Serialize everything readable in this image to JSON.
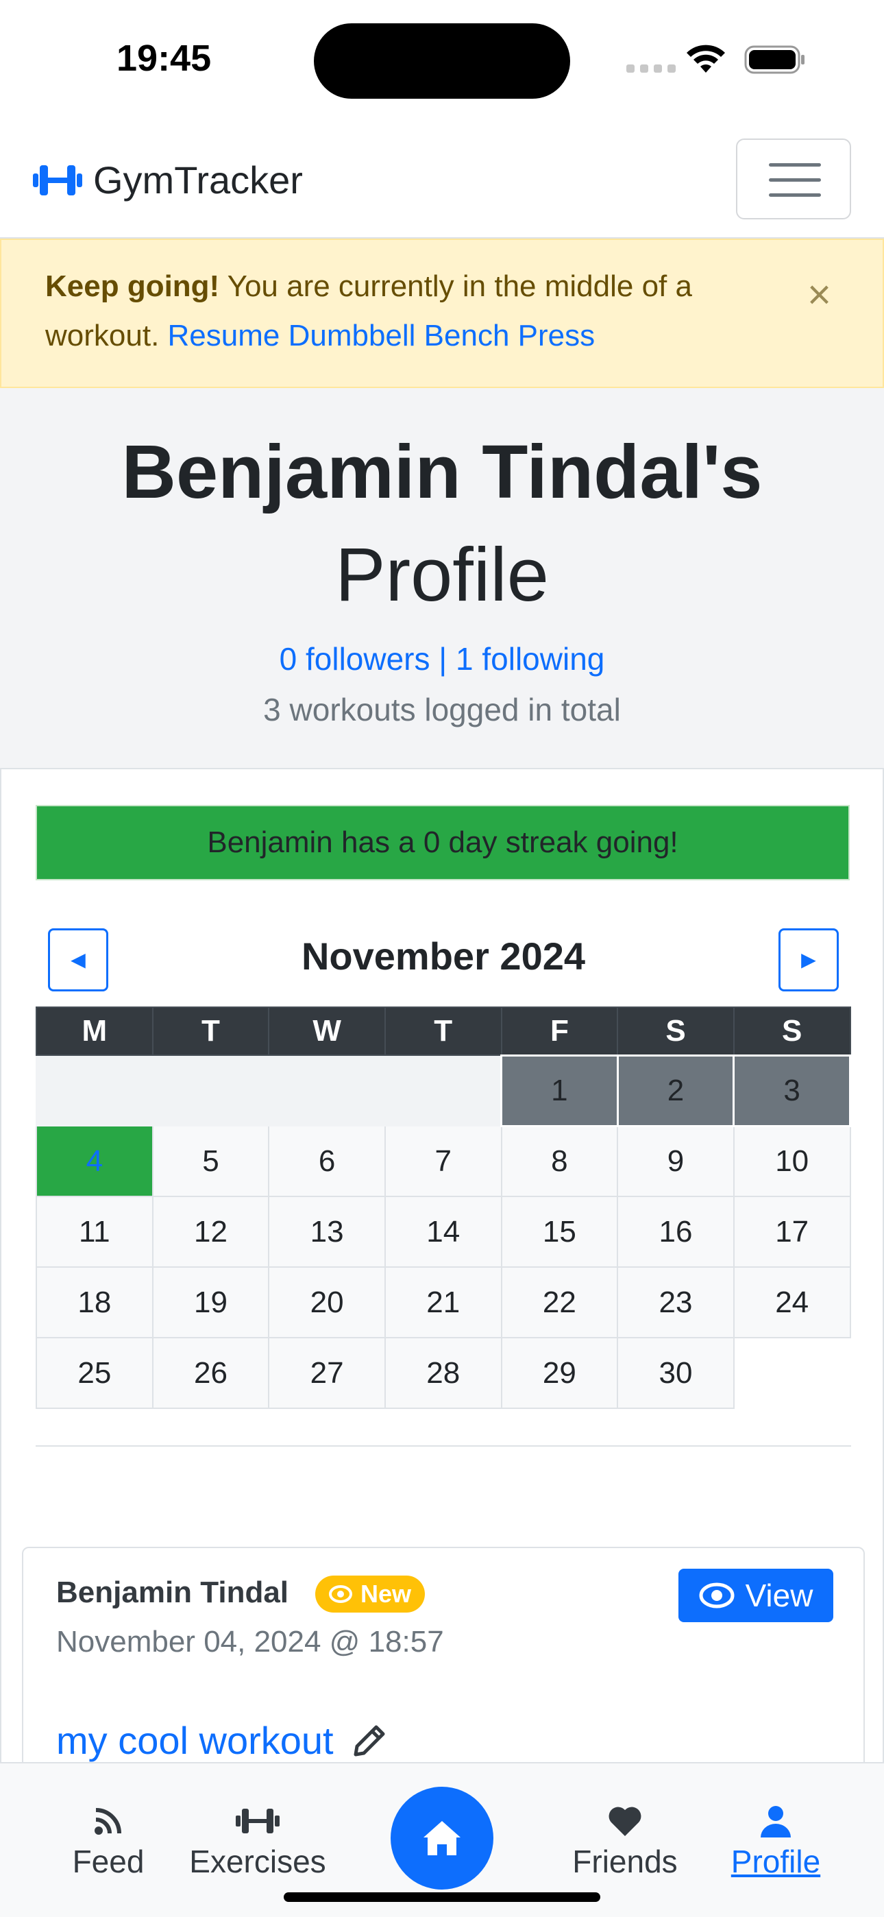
{
  "status_bar": {
    "time": "19:45"
  },
  "navbar": {
    "brand": "GymTracker"
  },
  "alert": {
    "strong": "Keep going!",
    "text": " You are currently in the middle of a workout. ",
    "link": "Resume Dumbbell Bench Press",
    "close": "×"
  },
  "profile": {
    "name": "Benjamin Tindal's",
    "title_suffix": "Profile",
    "followers": "0 followers",
    "separator": " | ",
    "following": "1 following",
    "workouts_total": "3 workouts logged in total"
  },
  "streak": "Benjamin has a 0 day streak going!",
  "calendar": {
    "month": "November 2024",
    "prev": "◄",
    "next": "►",
    "weekdays": [
      "M",
      "T",
      "W",
      "T",
      "F",
      "S",
      "S"
    ],
    "days": [
      "1",
      "2",
      "3",
      "4",
      "5",
      "6",
      "7",
      "8",
      "9",
      "10",
      "11",
      "12",
      "13",
      "14",
      "15",
      "16",
      "17",
      "18",
      "19",
      "20",
      "21",
      "22",
      "23",
      "24",
      "25",
      "26",
      "27",
      "28",
      "29",
      "30"
    ]
  },
  "workout": {
    "author": "Benjamin Tindal",
    "badge": "New",
    "view_label": "View",
    "date": "November 04, 2024 @ 18:57",
    "title": "my cool workout"
  },
  "bottom_nav": {
    "feed": "Feed",
    "exercises": "Exercises",
    "friends": "Friends",
    "profile": "Profile"
  },
  "colors": {
    "primary": "#0d6efd",
    "success": "#28a745",
    "warning_bg": "#fff3cd",
    "badge": "#ffc107",
    "dark": "#343a40"
  }
}
